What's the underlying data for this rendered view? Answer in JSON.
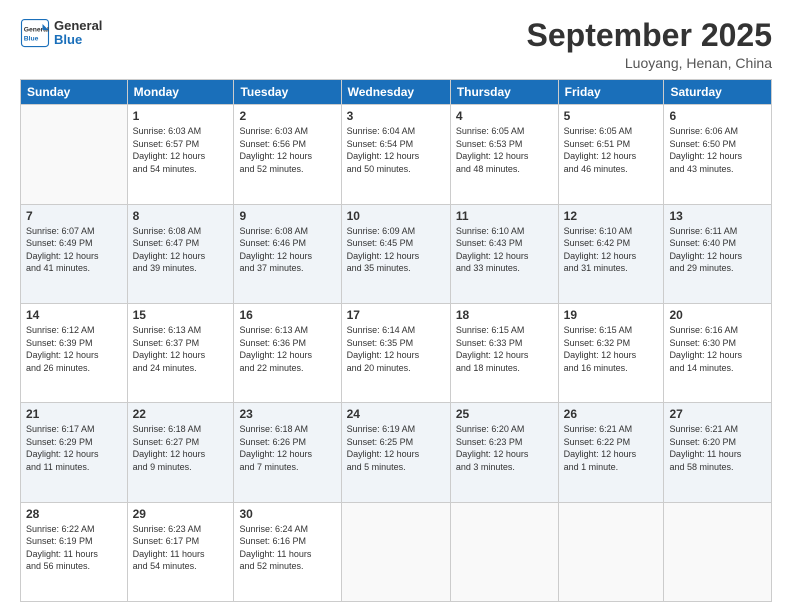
{
  "header": {
    "logo_general": "General",
    "logo_blue": "Blue",
    "month_title": "September 2025",
    "location": "Luoyang, Henan, China"
  },
  "days_of_week": [
    "Sunday",
    "Monday",
    "Tuesday",
    "Wednesday",
    "Thursday",
    "Friday",
    "Saturday"
  ],
  "weeks": [
    [
      {
        "day": "",
        "info": ""
      },
      {
        "day": "1",
        "info": "Sunrise: 6:03 AM\nSunset: 6:57 PM\nDaylight: 12 hours\nand 54 minutes."
      },
      {
        "day": "2",
        "info": "Sunrise: 6:03 AM\nSunset: 6:56 PM\nDaylight: 12 hours\nand 52 minutes."
      },
      {
        "day": "3",
        "info": "Sunrise: 6:04 AM\nSunset: 6:54 PM\nDaylight: 12 hours\nand 50 minutes."
      },
      {
        "day": "4",
        "info": "Sunrise: 6:05 AM\nSunset: 6:53 PM\nDaylight: 12 hours\nand 48 minutes."
      },
      {
        "day": "5",
        "info": "Sunrise: 6:05 AM\nSunset: 6:51 PM\nDaylight: 12 hours\nand 46 minutes."
      },
      {
        "day": "6",
        "info": "Sunrise: 6:06 AM\nSunset: 6:50 PM\nDaylight: 12 hours\nand 43 minutes."
      }
    ],
    [
      {
        "day": "7",
        "info": "Sunrise: 6:07 AM\nSunset: 6:49 PM\nDaylight: 12 hours\nand 41 minutes."
      },
      {
        "day": "8",
        "info": "Sunrise: 6:08 AM\nSunset: 6:47 PM\nDaylight: 12 hours\nand 39 minutes."
      },
      {
        "day": "9",
        "info": "Sunrise: 6:08 AM\nSunset: 6:46 PM\nDaylight: 12 hours\nand 37 minutes."
      },
      {
        "day": "10",
        "info": "Sunrise: 6:09 AM\nSunset: 6:45 PM\nDaylight: 12 hours\nand 35 minutes."
      },
      {
        "day": "11",
        "info": "Sunrise: 6:10 AM\nSunset: 6:43 PM\nDaylight: 12 hours\nand 33 minutes."
      },
      {
        "day": "12",
        "info": "Sunrise: 6:10 AM\nSunset: 6:42 PM\nDaylight: 12 hours\nand 31 minutes."
      },
      {
        "day": "13",
        "info": "Sunrise: 6:11 AM\nSunset: 6:40 PM\nDaylight: 12 hours\nand 29 minutes."
      }
    ],
    [
      {
        "day": "14",
        "info": "Sunrise: 6:12 AM\nSunset: 6:39 PM\nDaylight: 12 hours\nand 26 minutes."
      },
      {
        "day": "15",
        "info": "Sunrise: 6:13 AM\nSunset: 6:37 PM\nDaylight: 12 hours\nand 24 minutes."
      },
      {
        "day": "16",
        "info": "Sunrise: 6:13 AM\nSunset: 6:36 PM\nDaylight: 12 hours\nand 22 minutes."
      },
      {
        "day": "17",
        "info": "Sunrise: 6:14 AM\nSunset: 6:35 PM\nDaylight: 12 hours\nand 20 minutes."
      },
      {
        "day": "18",
        "info": "Sunrise: 6:15 AM\nSunset: 6:33 PM\nDaylight: 12 hours\nand 18 minutes."
      },
      {
        "day": "19",
        "info": "Sunrise: 6:15 AM\nSunset: 6:32 PM\nDaylight: 12 hours\nand 16 minutes."
      },
      {
        "day": "20",
        "info": "Sunrise: 6:16 AM\nSunset: 6:30 PM\nDaylight: 12 hours\nand 14 minutes."
      }
    ],
    [
      {
        "day": "21",
        "info": "Sunrise: 6:17 AM\nSunset: 6:29 PM\nDaylight: 12 hours\nand 11 minutes."
      },
      {
        "day": "22",
        "info": "Sunrise: 6:18 AM\nSunset: 6:27 PM\nDaylight: 12 hours\nand 9 minutes."
      },
      {
        "day": "23",
        "info": "Sunrise: 6:18 AM\nSunset: 6:26 PM\nDaylight: 12 hours\nand 7 minutes."
      },
      {
        "day": "24",
        "info": "Sunrise: 6:19 AM\nSunset: 6:25 PM\nDaylight: 12 hours\nand 5 minutes."
      },
      {
        "day": "25",
        "info": "Sunrise: 6:20 AM\nSunset: 6:23 PM\nDaylight: 12 hours\nand 3 minutes."
      },
      {
        "day": "26",
        "info": "Sunrise: 6:21 AM\nSunset: 6:22 PM\nDaylight: 12 hours\nand 1 minute."
      },
      {
        "day": "27",
        "info": "Sunrise: 6:21 AM\nSunset: 6:20 PM\nDaylight: 11 hours\nand 58 minutes."
      }
    ],
    [
      {
        "day": "28",
        "info": "Sunrise: 6:22 AM\nSunset: 6:19 PM\nDaylight: 11 hours\nand 56 minutes."
      },
      {
        "day": "29",
        "info": "Sunrise: 6:23 AM\nSunset: 6:17 PM\nDaylight: 11 hours\nand 54 minutes."
      },
      {
        "day": "30",
        "info": "Sunrise: 6:24 AM\nSunset: 6:16 PM\nDaylight: 11 hours\nand 52 minutes."
      },
      {
        "day": "",
        "info": ""
      },
      {
        "day": "",
        "info": ""
      },
      {
        "day": "",
        "info": ""
      },
      {
        "day": "",
        "info": ""
      }
    ]
  ]
}
